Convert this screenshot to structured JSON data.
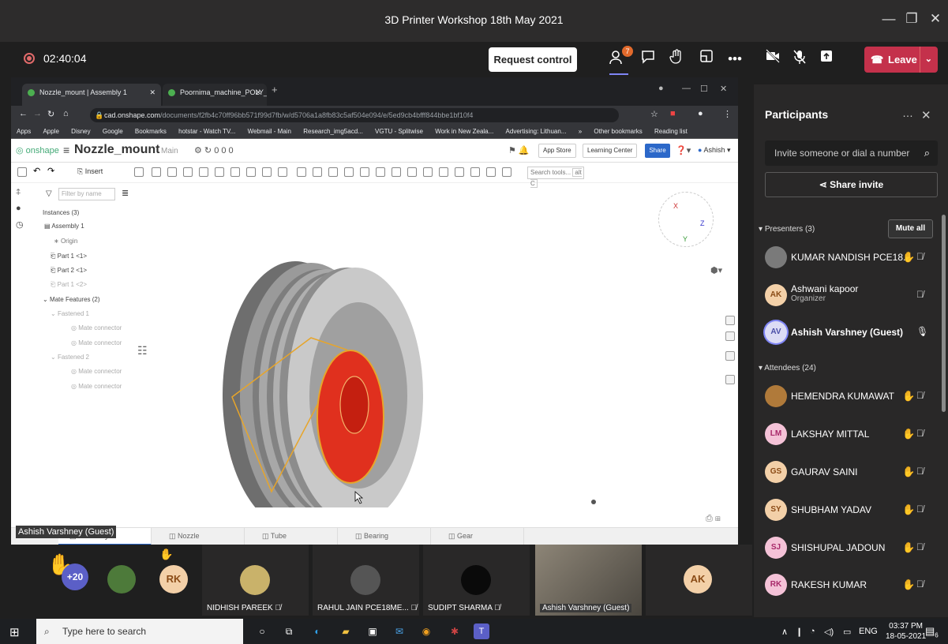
{
  "window": {
    "title": "3D Printer Workshop 18th May 2021",
    "minimize": "—",
    "maximize": "❐",
    "close": "✕"
  },
  "meeting": {
    "timer": "02:40:04",
    "request_control": "Request control",
    "participants_badge": "7",
    "leave": "Leave"
  },
  "browser": {
    "tabs": [
      {
        "label": "Nozzle_mount | Assembly 1"
      },
      {
        "label": "Poornima_machine_POLY_VX | Fr"
      }
    ],
    "url_host": "cad.onshape.com",
    "url_path": "/documents/f2fb4c70ff96bb571f99d7fb/w/d5706a1a8fb83c5af504e094/e/5ed9cb4bfff844bbe1bf10f4",
    "bookmarks": [
      "Apps",
      "Apple",
      "Disney",
      "Google",
      "Bookmarks",
      "hotstar - Watch TV...",
      "Webmail - Main",
      "Research_img5acd...",
      "VGTU - Splitwise",
      "Work in New Zeala...",
      "Advertising: Lithuan...",
      "»",
      "Other bookmarks",
      "Reading list"
    ]
  },
  "onshape": {
    "logo": "onshape",
    "doc_name": "Nozzle_mount",
    "branch": "Main",
    "counters": "0   0   0",
    "app_store": "App Store",
    "learning_center": "Learning Center",
    "share": "Share",
    "user": "Ashish",
    "search_tools": "Search tools...",
    "search_shortcut": "alt C",
    "filter_placeholder": "Filter by name",
    "tree": {
      "instances": "Instances (3)",
      "assembly": "Assembly 1",
      "origin": "Origin",
      "part1": "Part 1 <1>",
      "part2": "Part 2 <1>",
      "part1b": "Part 1 <2>",
      "mate_features": "Mate Features (2)",
      "fastened1": "Fastened 1",
      "mate_connector": "Mate connector",
      "fastened2": "Fastened 2"
    },
    "bottom_tabs": [
      "Assembly 1",
      "Nozzle",
      "Tube",
      "Bearing",
      "Gear"
    ]
  },
  "sharer_label": "Ashish Varshney (Guest)",
  "participants_panel": {
    "title": "Participants",
    "more": "…",
    "close": "✕",
    "invite_placeholder": "Invite someone or dial a number",
    "share_invite": "Share invite",
    "presenters_label": "Presenters (3)",
    "mute_all": "Mute all",
    "presenters": [
      {
        "initials": "",
        "name": "KUMAR NANDISH PCE18...",
        "role": "",
        "hand": true
      },
      {
        "initials": "AK",
        "name": "Ashwani kapoor",
        "role": "Organizer",
        "hand": false
      },
      {
        "initials": "AV",
        "name": "Ashish Varshney (Guest)",
        "role": "",
        "hand": false
      }
    ],
    "attendees_label": "Attendees (24)",
    "attendees": [
      {
        "initials": "",
        "name": "HEMENDRA KUMAWAT"
      },
      {
        "initials": "LM",
        "name": "LAKSHAY MITTAL"
      },
      {
        "initials": "GS",
        "name": "GAURAV SAINI"
      },
      {
        "initials": "SY",
        "name": "SHUBHAM YADAV"
      },
      {
        "initials": "SJ",
        "name": "SHISHUPAL JADOUN"
      },
      {
        "initials": "RK",
        "name": "RAKESH KUMAR"
      }
    ]
  },
  "video_strip": {
    "overflow": "+20",
    "tiles": [
      {
        "initials": "RK",
        "name": ""
      },
      {
        "initials": "",
        "name": "NIDHISH PAREEK"
      },
      {
        "initials": "",
        "name": "RAHUL JAIN PCE18ME..."
      },
      {
        "initials": "",
        "name": "SUDIPT SHARMA"
      },
      {
        "initials": "",
        "name": "Ashish Varshney (Guest)"
      },
      {
        "initials": "AK",
        "name": ""
      }
    ]
  },
  "taskbar": {
    "search_placeholder": "Type here to search",
    "tray_lang": "ENG",
    "time": "03:37 PM",
    "date": "18-05-2021",
    "notif_count": "6"
  },
  "colors": {
    "teams_dark": "#1f1f1f",
    "leave_red": "#c4314b",
    "accent_purple": "#7f85f5",
    "part_red": "#e0301e",
    "onshape_blue": "#2c68c9"
  }
}
